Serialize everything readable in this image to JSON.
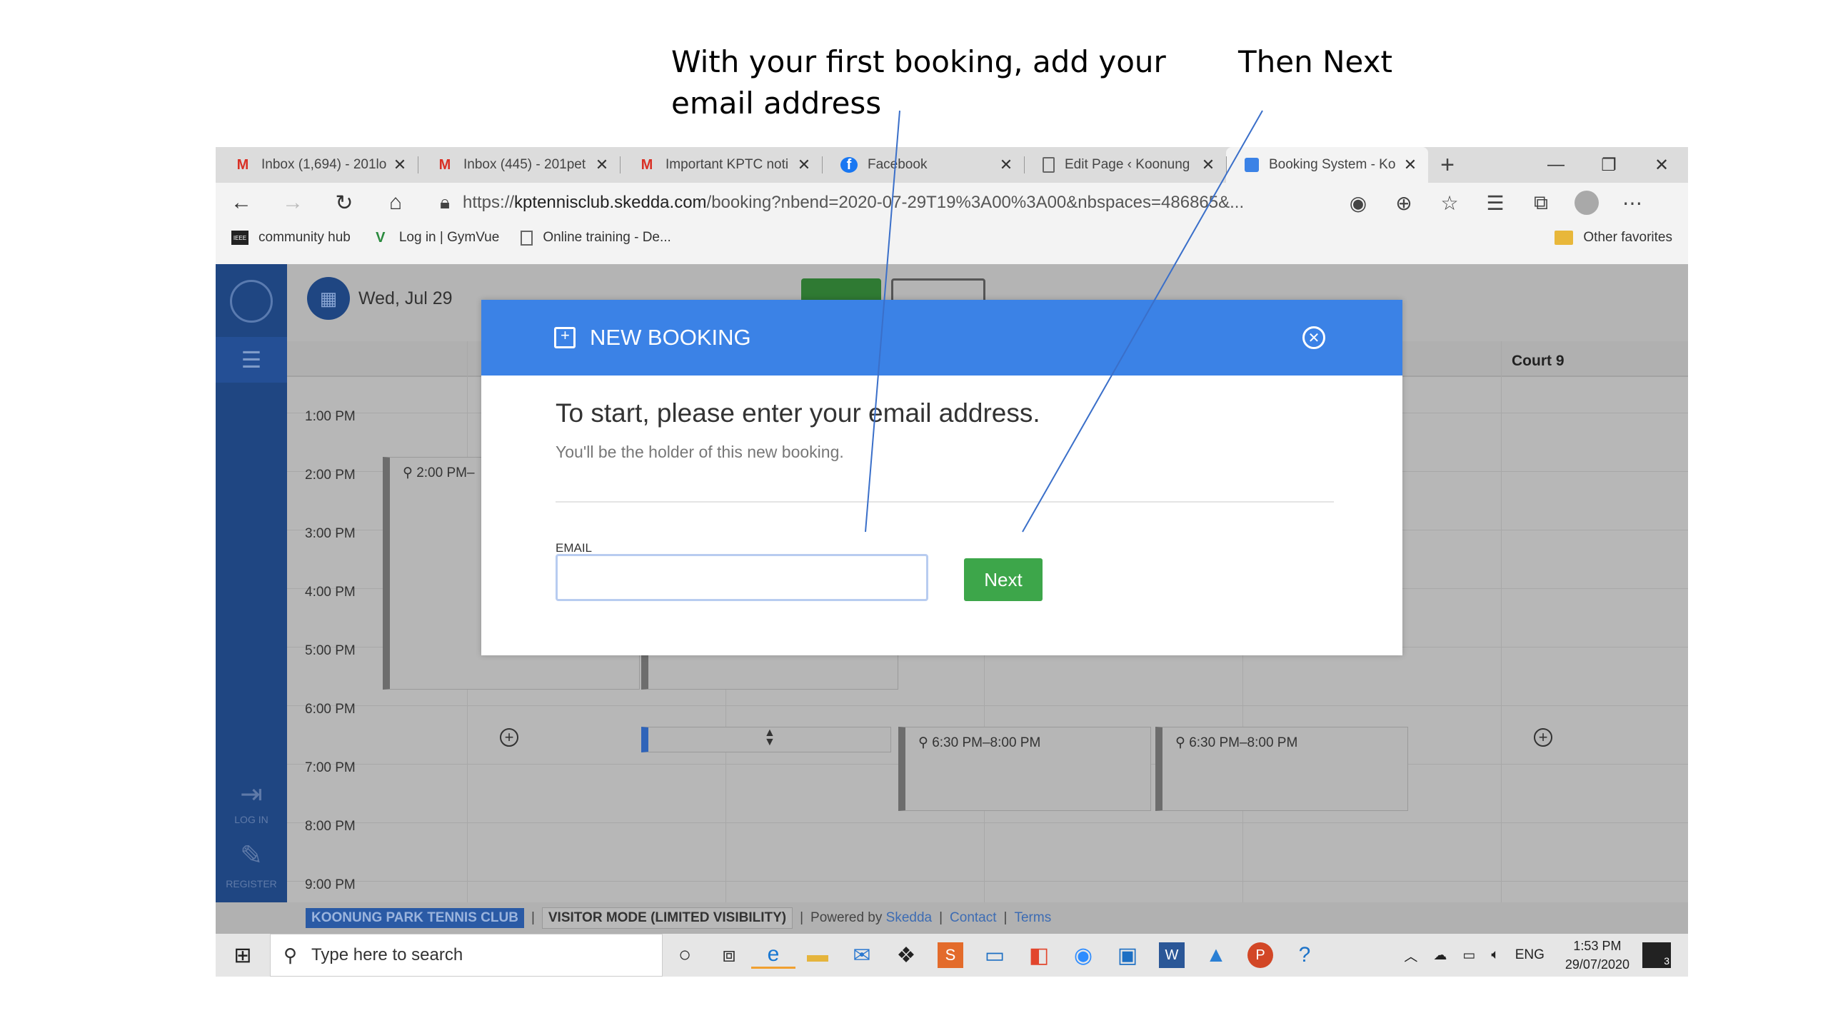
{
  "annotations": {
    "callout_1": "With your first booking, add your email address",
    "callout_2": "Then Next"
  },
  "browser": {
    "tabs": [
      {
        "label": "Inbox (1,694) - 201lo",
        "icon": "gmail-icon"
      },
      {
        "label": "Inbox (445) - 201pet",
        "icon": "gmail-icon"
      },
      {
        "label": "Important KPTC noti",
        "icon": "gmail-icon"
      },
      {
        "label": "Facebook",
        "icon": "facebook-icon"
      },
      {
        "label": "Edit Page ‹ Koonung",
        "icon": "page-icon"
      },
      {
        "label": "Booking System - Ko",
        "icon": "skedda-icon",
        "active": true
      }
    ],
    "url_prefix": "https://",
    "url_domain": "kptennisclub.skedda.com",
    "url_rest": "/booking?nbend=2020-07-29T19%3A00%3A00&nbspaces=486865&...",
    "favorites": [
      {
        "label": "community hub",
        "icon": "ieee-icon"
      },
      {
        "label": "Log in | GymVue",
        "icon": "gymvue-icon"
      },
      {
        "label": "Online training - De...",
        "icon": "page-icon"
      }
    ],
    "other_favorites": "Other favorites"
  },
  "app": {
    "date": "Wed, Jul 29",
    "court_header": "Court 9",
    "times": [
      "1:00 PM",
      "2:00 PM",
      "3:00 PM",
      "4:00 PM",
      "5:00 PM",
      "6:00 PM",
      "7:00 PM",
      "8:00 PM",
      "9:00 PM"
    ],
    "events": [
      {
        "label": "2:00 PM–"
      },
      {
        "label": "6:30 PM–8:00 PM"
      },
      {
        "label": "6:30 PM–8:00 PM"
      }
    ],
    "nav": {
      "login": "LOG IN",
      "register": "REGISTER"
    },
    "footer": {
      "club": "KOONUNG PARK TENNIS CLUB",
      "mode": "VISITOR MODE (LIMITED VISIBILITY)",
      "powered": "Powered by",
      "skedda": "Skedda",
      "contact": "Contact",
      "terms": "Terms",
      "sep": "|"
    }
  },
  "modal": {
    "title": "NEW BOOKING",
    "heading": "To start, please enter your email address.",
    "subheading": "You'll be the holder of this new booking.",
    "email_label": "EMAIL",
    "email_value": "",
    "next_label": "Next"
  },
  "taskbar": {
    "search_placeholder": "Type here to search",
    "lang": "ENG",
    "time": "1:53 PM",
    "date": "29/07/2020",
    "notifications": "3"
  },
  "colors": {
    "modal_header": "#3b82e6",
    "next_button": "#3da64a",
    "nav_dark_blue": "#1f4682"
  }
}
